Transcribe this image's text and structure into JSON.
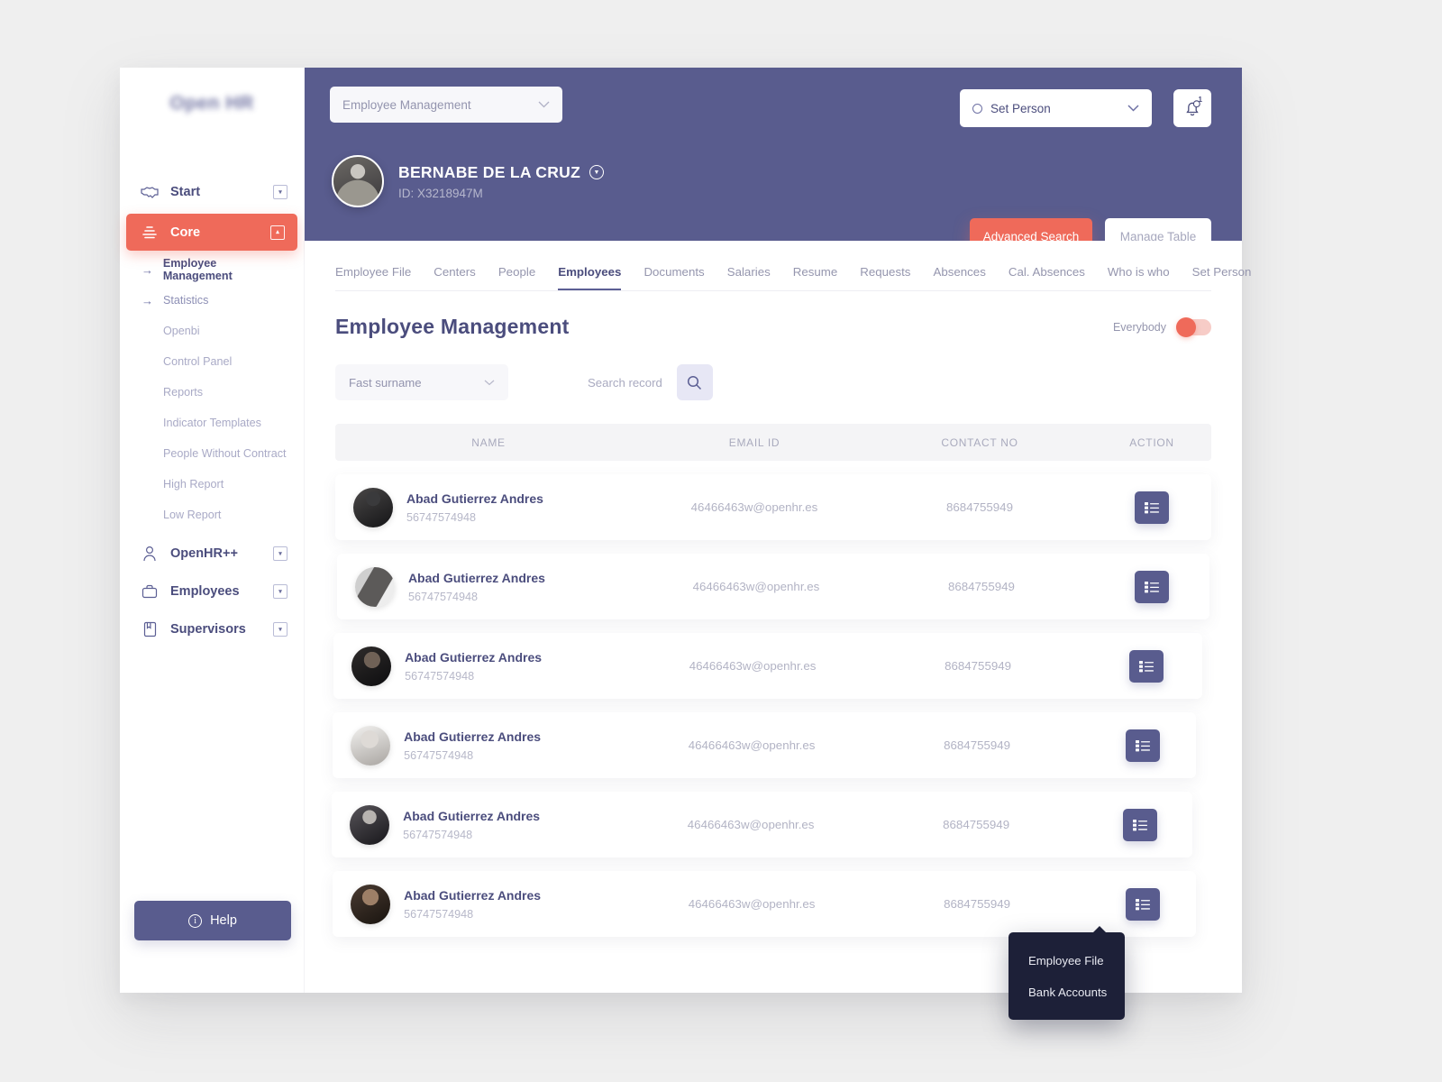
{
  "app": {
    "logo": "Open HR"
  },
  "sidebar": {
    "top_items": [
      {
        "label": "Start",
        "icon": "handshake-icon",
        "expander": "▾",
        "active": false
      },
      {
        "label": "Core",
        "icon": "layers-icon",
        "expander": "▴",
        "active": true
      }
    ],
    "sub_items": [
      {
        "label": "Employee Management",
        "style": "strong",
        "arrow": "→"
      },
      {
        "label": "Statistics",
        "style": "semi",
        "arrow": "→"
      },
      {
        "label": "Openbi",
        "style": "plain",
        "arrow": ""
      },
      {
        "label": "Control Panel",
        "style": "plain",
        "arrow": ""
      },
      {
        "label": "Reports",
        "style": "plain",
        "arrow": ""
      },
      {
        "label": "Indicator Templates",
        "style": "plain",
        "arrow": ""
      },
      {
        "label": "People Without Contract",
        "style": "plain",
        "arrow": ""
      },
      {
        "label": "High Report",
        "style": "plain",
        "arrow": ""
      },
      {
        "label": "Low Report",
        "style": "plain",
        "arrow": ""
      }
    ],
    "bottom_items": [
      {
        "label": "OpenHR++",
        "icon": "user-icon",
        "expander": "▾"
      },
      {
        "label": "Employees",
        "icon": "briefcase-icon",
        "expander": "▾"
      },
      {
        "label": "Supervisors",
        "icon": "id-card-icon",
        "expander": "▾"
      }
    ],
    "help_label": "Help"
  },
  "topbar": {
    "module_select": "Employee Management",
    "person_select": "Set Person",
    "notification_count": "1",
    "person_name": "BERNABE DE LA CRUZ",
    "person_id": "ID: X3218947M",
    "advanced_search_label": "Advanced Search",
    "manage_table_label": "Manage Table"
  },
  "tabs": [
    {
      "label": "Employee File",
      "active": false
    },
    {
      "label": "Centers",
      "active": false
    },
    {
      "label": "People",
      "active": false
    },
    {
      "label": "Employees",
      "active": true
    },
    {
      "label": "Documents",
      "active": false
    },
    {
      "label": "Salaries",
      "active": false
    },
    {
      "label": "Resume",
      "active": false
    },
    {
      "label": "Requests",
      "active": false
    },
    {
      "label": "Absences",
      "active": false
    },
    {
      "label": "Cal. Absences",
      "active": false
    },
    {
      "label": "Who is who",
      "active": false
    },
    {
      "label": "Set Person",
      "active": false
    }
  ],
  "page": {
    "title": "Employee Management",
    "toggle_label": "Everybody",
    "toggle_on": false
  },
  "filters": {
    "surname_select": "Fast surname",
    "search_placeholder": "Search record"
  },
  "table": {
    "columns": [
      "NAME",
      "EMAIL ID",
      "CONTACT NO",
      "ACTION"
    ],
    "rows": [
      {
        "name": "Abad Gutierrez Andres",
        "number": "56747574948",
        "email": "46466463w@openhr.es",
        "contact": "8684755949"
      },
      {
        "name": "Abad Gutierrez Andres",
        "number": "56747574948",
        "email": "46466463w@openhr.es",
        "contact": "8684755949"
      },
      {
        "name": "Abad Gutierrez Andres",
        "number": "56747574948",
        "email": "46466463w@openhr.es",
        "contact": "8684755949"
      },
      {
        "name": "Abad Gutierrez Andres",
        "number": "56747574948",
        "email": "46466463w@openhr.es",
        "contact": "8684755949"
      },
      {
        "name": "Abad Gutierrez Andres",
        "number": "56747574948",
        "email": "46466463w@openhr.es",
        "contact": "8684755949"
      },
      {
        "name": "Abad Gutierrez Andres",
        "number": "56747574948",
        "email": "46466463w@openhr.es",
        "contact": "8684755949"
      }
    ]
  },
  "context_menu": {
    "items": [
      {
        "label": "Employee File"
      },
      {
        "label": "Bank Accounts"
      }
    ]
  },
  "colors": {
    "accent_coral": "#ef6a5a",
    "brand_purple": "#595c8e",
    "text_dark": "#4b4d7d",
    "page_bg": "#efefef",
    "menu_dark": "#1d2038"
  }
}
